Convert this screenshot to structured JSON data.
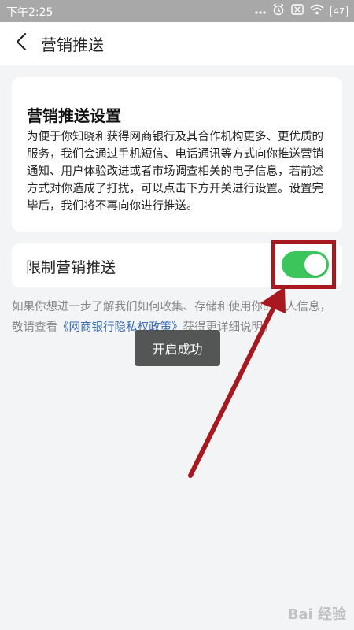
{
  "status_bar": {
    "time": "下午2:25",
    "battery": "47",
    "icons": [
      "dots-icon",
      "alarm-icon",
      "sim-off-icon",
      "wifi-icon",
      "battery-icon"
    ]
  },
  "header": {
    "back_icon": "chevron-left-icon",
    "title": "营销推送"
  },
  "card": {
    "title": "营销推送设置",
    "description": "为便于你知晓和获得网商银行及其合作机构更多、更优质的服务，我们会通过手机短信、电话通讯等方式向你推送营销通知、用户体验改进或者市场调查相关的电子信息，若前述方式对你造成了打扰，可以点击下方开关进行设置。设置完毕后，我们将不再向你进行推送。"
  },
  "toggle": {
    "label": "限制营销推送",
    "state": "on",
    "color": "#3cc55a"
  },
  "privacy": {
    "prefix": "如果你想进一步了解我们如何收集、存储和使用你的个人信息，敬请查看",
    "link": "《网商银行隐私权政策》",
    "suffix": "获得更详细说明。",
    "link_color": "#3b6fb6"
  },
  "toast": {
    "text": "开启成功"
  },
  "annotation": {
    "color": "#a8181e"
  },
  "watermark": {
    "text": "Bai 经验"
  }
}
